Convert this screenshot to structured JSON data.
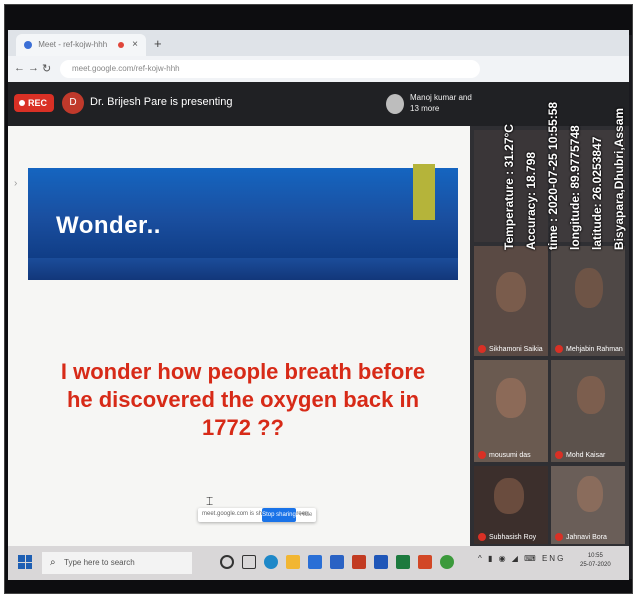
{
  "browser": {
    "tab_title": "Meet - ref-kojw-hhh",
    "tab_close": "×",
    "new_tab": "+",
    "url": "meet.google.com/ref-kojw-hhh"
  },
  "meet": {
    "rec_label": "REC",
    "presenter_initial": "D",
    "presenter_text": "Dr. Brijesh Pare is presenting",
    "participants_text": "Manoj kumar and 13 more"
  },
  "slide": {
    "heading": "Wonder..",
    "body_lines": [
      "I wonder how people breath before",
      "he discovered the oxygen back in",
      "1772 ??"
    ],
    "share_text": "meet.google.com is sharing your screen.",
    "share_button": "Stop sharing",
    "share_hide": "Hide"
  },
  "participants": [
    {
      "name": "Sikhamoni Saikia"
    },
    {
      "name": "Mehjabin Rahman"
    },
    {
      "name": "mousumi das"
    },
    {
      "name": "Mohd Kaisar"
    },
    {
      "name": "Subhasish Roy"
    },
    {
      "name": "Jahnavi Bora"
    }
  ],
  "overlay": {
    "temperature": "Temperature :  31.27°C",
    "accuracy": "Accuracy: 18.798",
    "time": "time :  2020-07-25 10:55:58",
    "longitude": "longitude:  89.9775748",
    "latitude": "latitude:  26.0253847",
    "location": "Bisyapara,Dhubri,Assam"
  },
  "taskbar": {
    "search_placeholder": "Type here to search",
    "tray_icons": "^ ▮ ◉ ◢ ⌨ ENG",
    "clock_time": "10:55",
    "clock_date": "25-07-2020"
  },
  "colors": {
    "slide_text": "#d72a17",
    "banner_blue": "#1565c0",
    "accent_olive": "#b5b43a",
    "rec_red": "#d93025",
    "meet_bar": "#202124"
  }
}
